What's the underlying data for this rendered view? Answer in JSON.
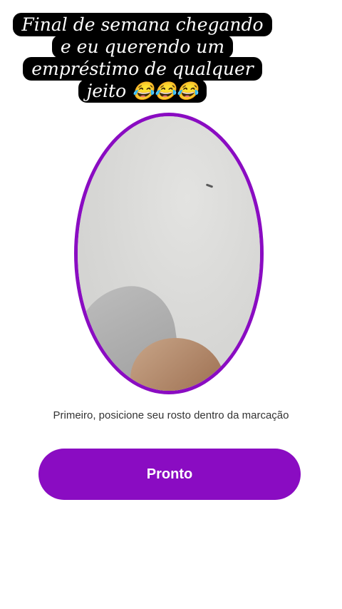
{
  "story_caption": {
    "lines": [
      "Final de semana chegando",
      "e eu querendo um",
      "empréstimo de qualquer",
      "jeito 😂😂😂"
    ]
  },
  "face_capture": {
    "instruction": "Primeiro, posicione seu rosto dentro da marcação",
    "confirm_label": "Pronto"
  },
  "colors": {
    "accent": "#8a0cc2",
    "caption_background": "#000000",
    "caption_text": "#ffffff"
  }
}
